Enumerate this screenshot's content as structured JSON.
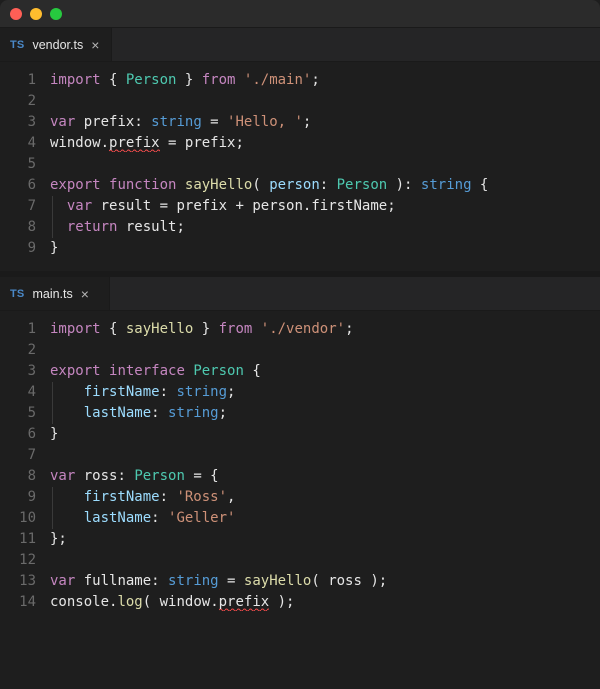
{
  "editor": {
    "titlebar": {
      "traffic": [
        "close",
        "minimize",
        "zoom"
      ]
    },
    "panes": [
      {
        "tab": {
          "language": "TS",
          "filename": "vendor.ts",
          "closeGlyph": "×"
        },
        "lines": [
          {
            "n": "1",
            "tokens": [
              [
                "kw",
                "import"
              ],
              [
                "punc",
                " { "
              ],
              [
                "type",
                "Person"
              ],
              [
                "punc",
                " } "
              ],
              [
                "kw",
                "from"
              ],
              [
                "punc",
                " "
              ],
              [
                "str",
                "'./main'"
              ],
              [
                "punc",
                ";"
              ]
            ]
          },
          {
            "n": "2",
            "tokens": []
          },
          {
            "n": "3",
            "tokens": [
              [
                "kw",
                "var"
              ],
              [
                "punc",
                " "
              ],
              [
                "id",
                "prefix"
              ],
              [
                "punc",
                ": "
              ],
              [
                "kwt",
                "string"
              ],
              [
                "punc",
                " = "
              ],
              [
                "str",
                "'Hello, '"
              ],
              [
                "punc",
                ";"
              ]
            ]
          },
          {
            "n": "4",
            "tokens": [
              [
                "obj",
                "window"
              ],
              [
                "punc",
                "."
              ],
              [
                "squig",
                "prefix"
              ],
              [
                "punc",
                " = "
              ],
              [
                "id",
                "prefix"
              ],
              [
                "punc",
                ";"
              ]
            ]
          },
          {
            "n": "5",
            "tokens": []
          },
          {
            "n": "6",
            "tokens": [
              [
                "kw",
                "export"
              ],
              [
                "punc",
                " "
              ],
              [
                "kw",
                "function"
              ],
              [
                "punc",
                " "
              ],
              [
                "fn",
                "sayHello"
              ],
              [
                "punc",
                "( "
              ],
              [
                "prm",
                "person"
              ],
              [
                "punc",
                ": "
              ],
              [
                "type",
                "Person"
              ],
              [
                "punc",
                " ): "
              ],
              [
                "kwt",
                "string"
              ],
              [
                "punc",
                " {"
              ]
            ]
          },
          {
            "n": "7",
            "guide": true,
            "tokens": [
              [
                "punc",
                "  "
              ],
              [
                "kw",
                "var"
              ],
              [
                "punc",
                " "
              ],
              [
                "id",
                "result"
              ],
              [
                "punc",
                " = "
              ],
              [
                "id",
                "prefix"
              ],
              [
                "punc",
                " + "
              ],
              [
                "id",
                "person"
              ],
              [
                "punc",
                "."
              ],
              [
                "id",
                "firstName"
              ],
              [
                "punc",
                ";"
              ]
            ]
          },
          {
            "n": "8",
            "guide": true,
            "tokens": [
              [
                "punc",
                "  "
              ],
              [
                "kw",
                "return"
              ],
              [
                "punc",
                " "
              ],
              [
                "id",
                "result"
              ],
              [
                "punc",
                ";"
              ]
            ]
          },
          {
            "n": "9",
            "tokens": [
              [
                "punc",
                "}"
              ]
            ]
          }
        ]
      },
      {
        "tab": {
          "language": "TS",
          "filename": "main.ts",
          "closeGlyph": "×"
        },
        "lines": [
          {
            "n": "1",
            "tokens": [
              [
                "kw",
                "import"
              ],
              [
                "punc",
                " { "
              ],
              [
                "fn",
                "sayHello"
              ],
              [
                "punc",
                " } "
              ],
              [
                "kw",
                "from"
              ],
              [
                "punc",
                " "
              ],
              [
                "str",
                "'./vendor'"
              ],
              [
                "punc",
                ";"
              ]
            ]
          },
          {
            "n": "2",
            "tokens": []
          },
          {
            "n": "3",
            "tokens": [
              [
                "kw",
                "export"
              ],
              [
                "punc",
                " "
              ],
              [
                "kw",
                "interface"
              ],
              [
                "punc",
                " "
              ],
              [
                "type",
                "Person"
              ],
              [
                "punc",
                " {"
              ]
            ]
          },
          {
            "n": "4",
            "guide": true,
            "tokens": [
              [
                "punc",
                "    "
              ],
              [
                "prop",
                "firstName"
              ],
              [
                "punc",
                ": "
              ],
              [
                "kwt",
                "string"
              ],
              [
                "punc",
                ";"
              ]
            ]
          },
          {
            "n": "5",
            "guide": true,
            "tokens": [
              [
                "punc",
                "    "
              ],
              [
                "prop",
                "lastName"
              ],
              [
                "punc",
                ": "
              ],
              [
                "kwt",
                "string"
              ],
              [
                "punc",
                ";"
              ]
            ]
          },
          {
            "n": "6",
            "tokens": [
              [
                "punc",
                "}"
              ]
            ]
          },
          {
            "n": "7",
            "tokens": []
          },
          {
            "n": "8",
            "tokens": [
              [
                "kw",
                "var"
              ],
              [
                "punc",
                " "
              ],
              [
                "id",
                "ross"
              ],
              [
                "punc",
                ": "
              ],
              [
                "type",
                "Person"
              ],
              [
                "punc",
                " = {"
              ]
            ]
          },
          {
            "n": "9",
            "guide": true,
            "tokens": [
              [
                "punc",
                "    "
              ],
              [
                "prop",
                "firstName"
              ],
              [
                "punc",
                ": "
              ],
              [
                "str",
                "'Ross'"
              ],
              [
                "punc",
                ","
              ]
            ]
          },
          {
            "n": "10",
            "guide": true,
            "tokens": [
              [
                "punc",
                "    "
              ],
              [
                "prop",
                "lastName"
              ],
              [
                "punc",
                ": "
              ],
              [
                "str",
                "'Geller'"
              ]
            ]
          },
          {
            "n": "11",
            "tokens": [
              [
                "punc",
                "};"
              ]
            ]
          },
          {
            "n": "12",
            "tokens": []
          },
          {
            "n": "13",
            "tokens": [
              [
                "kw",
                "var"
              ],
              [
                "punc",
                " "
              ],
              [
                "id",
                "fullname"
              ],
              [
                "punc",
                ": "
              ],
              [
                "kwt",
                "string"
              ],
              [
                "punc",
                " = "
              ],
              [
                "fn",
                "sayHello"
              ],
              [
                "punc",
                "( "
              ],
              [
                "id",
                "ross"
              ],
              [
                "punc",
                " );"
              ]
            ]
          },
          {
            "n": "14",
            "tokens": [
              [
                "obj",
                "console"
              ],
              [
                "punc",
                "."
              ],
              [
                "fn",
                "log"
              ],
              [
                "punc",
                "( "
              ],
              [
                "obj",
                "window"
              ],
              [
                "punc",
                "."
              ],
              [
                "squig",
                "prefix"
              ],
              [
                "punc",
                " );"
              ]
            ]
          }
        ]
      }
    ]
  }
}
